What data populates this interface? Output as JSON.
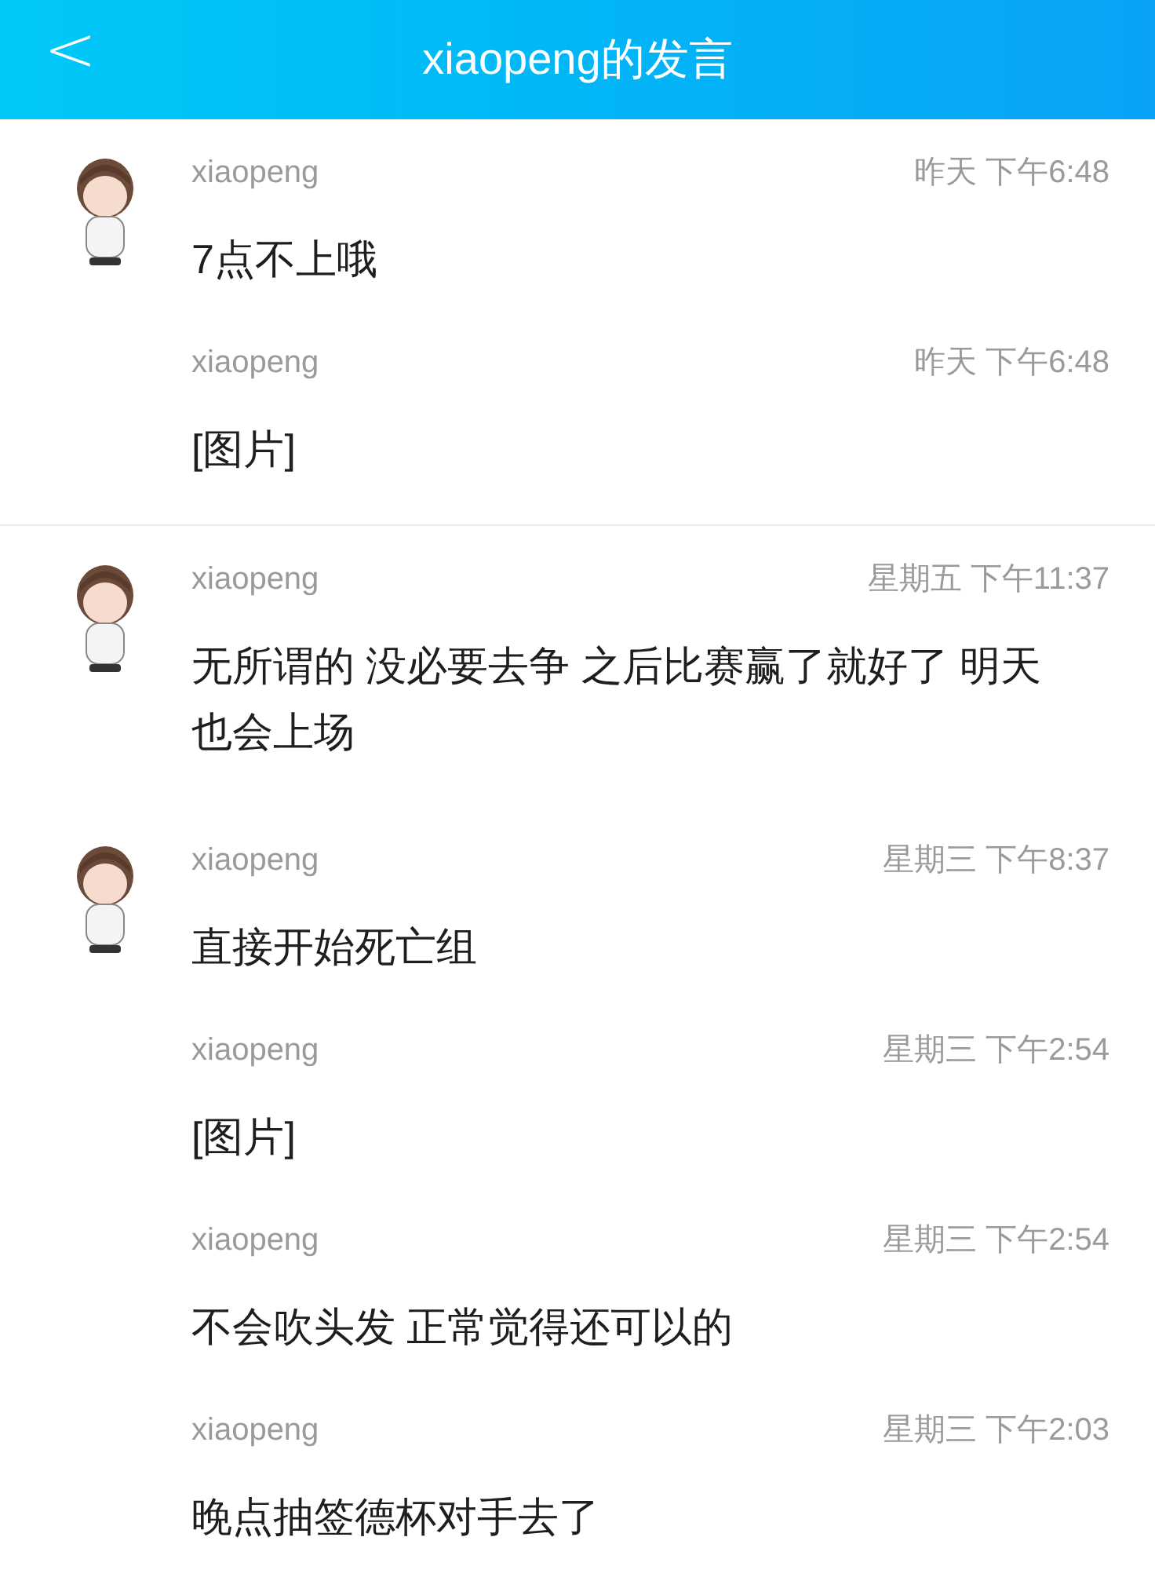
{
  "header": {
    "back_icon": "<",
    "title": "xiaopeng的发言"
  },
  "groups": [
    {
      "divider_above": false,
      "messages": [
        {
          "name": "xiaopeng",
          "time": "昨天 下午6:48",
          "text": "7点不上哦"
        },
        {
          "name": "xiaopeng",
          "time": "昨天 下午6:48",
          "text": "[图片]"
        }
      ]
    },
    {
      "divider_above": true,
      "messages": [
        {
          "name": "xiaopeng",
          "time": "星期五 下午11:37",
          "text": "无所谓的 没必要去争 之后比赛赢了就好了 明天也会上场"
        }
      ]
    },
    {
      "divider_above": false,
      "messages": [
        {
          "name": "xiaopeng",
          "time": "星期三 下午8:37",
          "text": "直接开始死亡组"
        },
        {
          "name": "xiaopeng",
          "time": "星期三 下午2:54",
          "text": "[图片]"
        },
        {
          "name": "xiaopeng",
          "time": "星期三 下午2:54",
          "text": "不会吹头发 正常觉得还可以的"
        },
        {
          "name": "xiaopeng",
          "time": "星期三 下午2:03",
          "text": "晚点抽签德杯对手去了"
        }
      ]
    }
  ]
}
